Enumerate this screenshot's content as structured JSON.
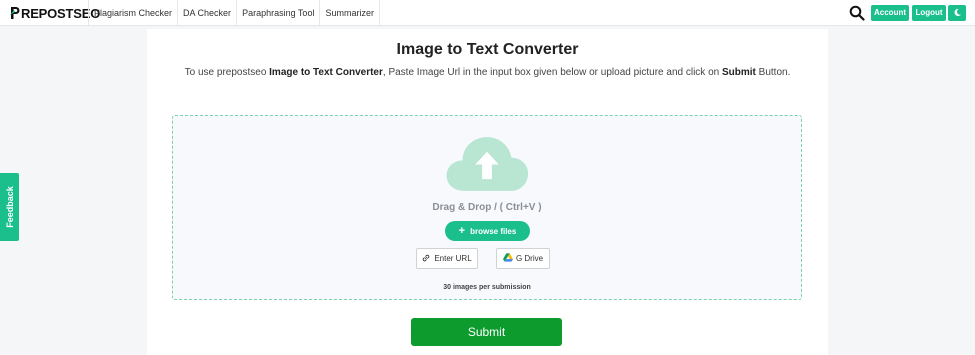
{
  "header": {
    "logo_text": "REPOSTSEO",
    "nav": [
      "Plagiarism Checker",
      "DA Checker",
      "Paraphrasing Tool",
      "Summarizer"
    ],
    "account_label": "Account",
    "logout_label": "Logout",
    "search_icon": "search-icon",
    "theme_icon": "moon-icon"
  },
  "feedback_label": "Feedback",
  "main": {
    "title": "Image to Text Converter",
    "subtitle": {
      "part1": "To use prepostseo ",
      "bold1": "Image to Text Converter",
      "part2": ", Paste Image Url in the input box given below or upload picture and click on ",
      "bold2": "Submit",
      "part3": " Button."
    },
    "dropzone": {
      "icon": "cloud-upload-icon",
      "drag_text": "Drag & Drop / ( Ctrl+V )",
      "browse_label": "browse files",
      "enter_url_label": "Enter URL",
      "gdrive_label": "G Drive",
      "limit_text": "30 images per submission"
    },
    "submit_label": "Submit"
  },
  "colors": {
    "accent": "#1bbf8c",
    "submit": "#0d9b2e",
    "dropzone_border": "#7fcfab",
    "cloud": "#b9e6d3"
  }
}
